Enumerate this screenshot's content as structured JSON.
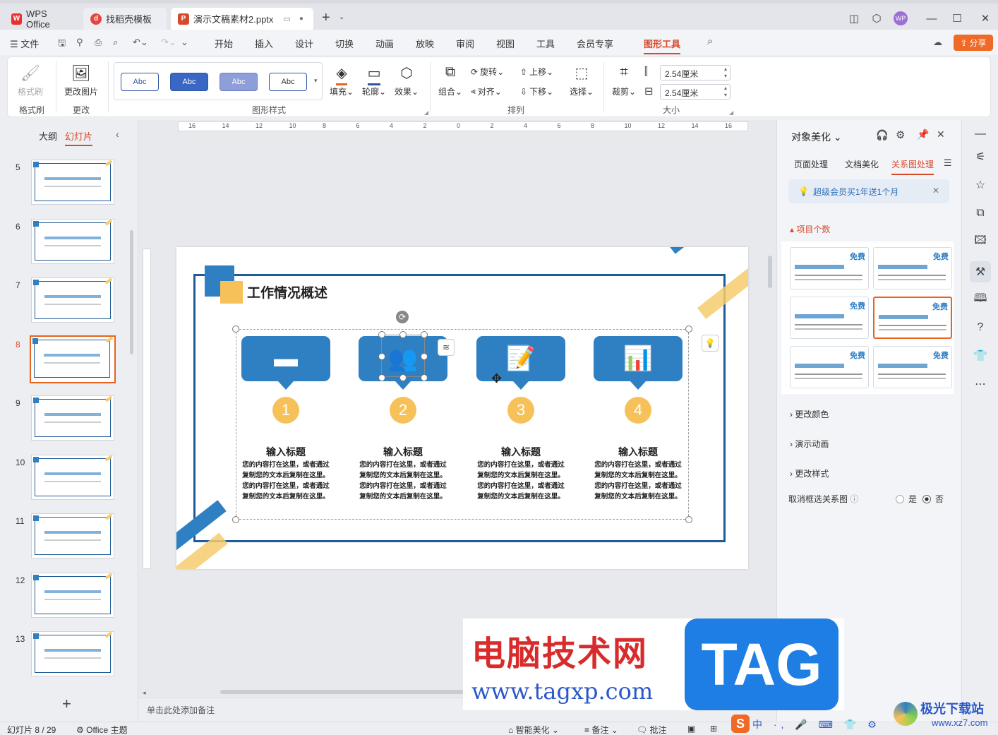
{
  "tabs": [
    {
      "label": "WPS Office",
      "icon": "wps-logo-icon"
    },
    {
      "label": "找稻壳模板",
      "icon": "docer-icon"
    },
    {
      "label": "演示文稿素材2.pptx",
      "icon": "ppt-icon"
    }
  ],
  "menu": {
    "file": "文件",
    "items": [
      "开始",
      "插入",
      "设计",
      "切换",
      "动画",
      "放映",
      "审阅",
      "视图",
      "工具",
      "会员专享",
      "图形工具"
    ],
    "active": "图形工具",
    "share": "分享",
    "avatar": "WP"
  },
  "ribbon": {
    "format_brush": "格式刷",
    "group_format_brush": "格式刷",
    "change_picture": "更改图片",
    "group_change": "更改",
    "style_samples": [
      "Abc",
      "Abc",
      "Abc",
      "Abc"
    ],
    "group_shape_style": "图形样式",
    "fill": "填充",
    "outline": "轮廓",
    "effect": "效果",
    "combine": "组合",
    "rotate": "旋转",
    "align": "对齐",
    "move_up": "上移",
    "move_down": "下移",
    "select": "选择",
    "group_arrange": "排列",
    "crop": "裁剪",
    "height": "2.54厘米",
    "width": "2.54厘米",
    "group_size": "大小"
  },
  "left_panel": {
    "tab_outline": "大纲",
    "tab_slides": "幻灯片",
    "slides": [
      "5",
      "6",
      "7",
      "8",
      "9",
      "10",
      "11",
      "12",
      "13"
    ],
    "selected": "8"
  },
  "ruler": {
    "labels": [
      "16",
      "14",
      "12",
      "10",
      "8",
      "6",
      "4",
      "2",
      "0",
      "2",
      "4",
      "6",
      "8",
      "10",
      "12",
      "14",
      "16"
    ]
  },
  "slide": {
    "title": "工作情况概述",
    "items": [
      {
        "num": "1",
        "title": "输入标题",
        "body": "您的内容打在这里，或者通过复制您的文本后复制在这里。您的内容打在这里，或者通过复制您的文本后复制在这里。",
        "icon": "wallet-icon"
      },
      {
        "num": "2",
        "title": "输入标题",
        "body": "您的内容打在这里，或者通过复制您的文本后复制在这里。您的内容打在这里，或者通过复制您的文本后复制在这里。",
        "icon": "team-icon"
      },
      {
        "num": "3",
        "title": "输入标题",
        "body": "您的内容打在这里，或者通过复制您的文本后复制在这里。您的内容打在这里，或者通过复制您的文本后复制在这里。",
        "icon": "notepad-icon"
      },
      {
        "num": "4",
        "title": "输入标题",
        "body": "您的内容打在这里，或者通过复制您的文本后复制在这里。您的内容打在这里，或者通过复制您的文本后复制在这里。",
        "icon": "bar-chart-icon"
      }
    ]
  },
  "notes_placeholder": "单击此处添加备注",
  "right_panel": {
    "title": "对象美化",
    "tabs": [
      "页面处理",
      "文档美化",
      "关系图处理"
    ],
    "active_tab": "关系图处理",
    "promo": "超级会员买1年送1个月",
    "section_count": "项目个数",
    "free_label": "免费",
    "change_color": "更改颜色",
    "animate": "演示动画",
    "change_style": "更改样式",
    "cancel_select": "取消框选关系图",
    "yes": "是",
    "no": "否"
  },
  "status": {
    "slide_info": "幻灯片 8 / 29",
    "theme": "Office 主题",
    "smart": "智能美化",
    "notes": "备注",
    "comment": "批注"
  },
  "watermark": {
    "cn": "电脑技术网",
    "url": "www.tagxp.com",
    "tag": "TAG",
    "corner": "极光下载站",
    "corner_url": "www.xz7.com"
  }
}
